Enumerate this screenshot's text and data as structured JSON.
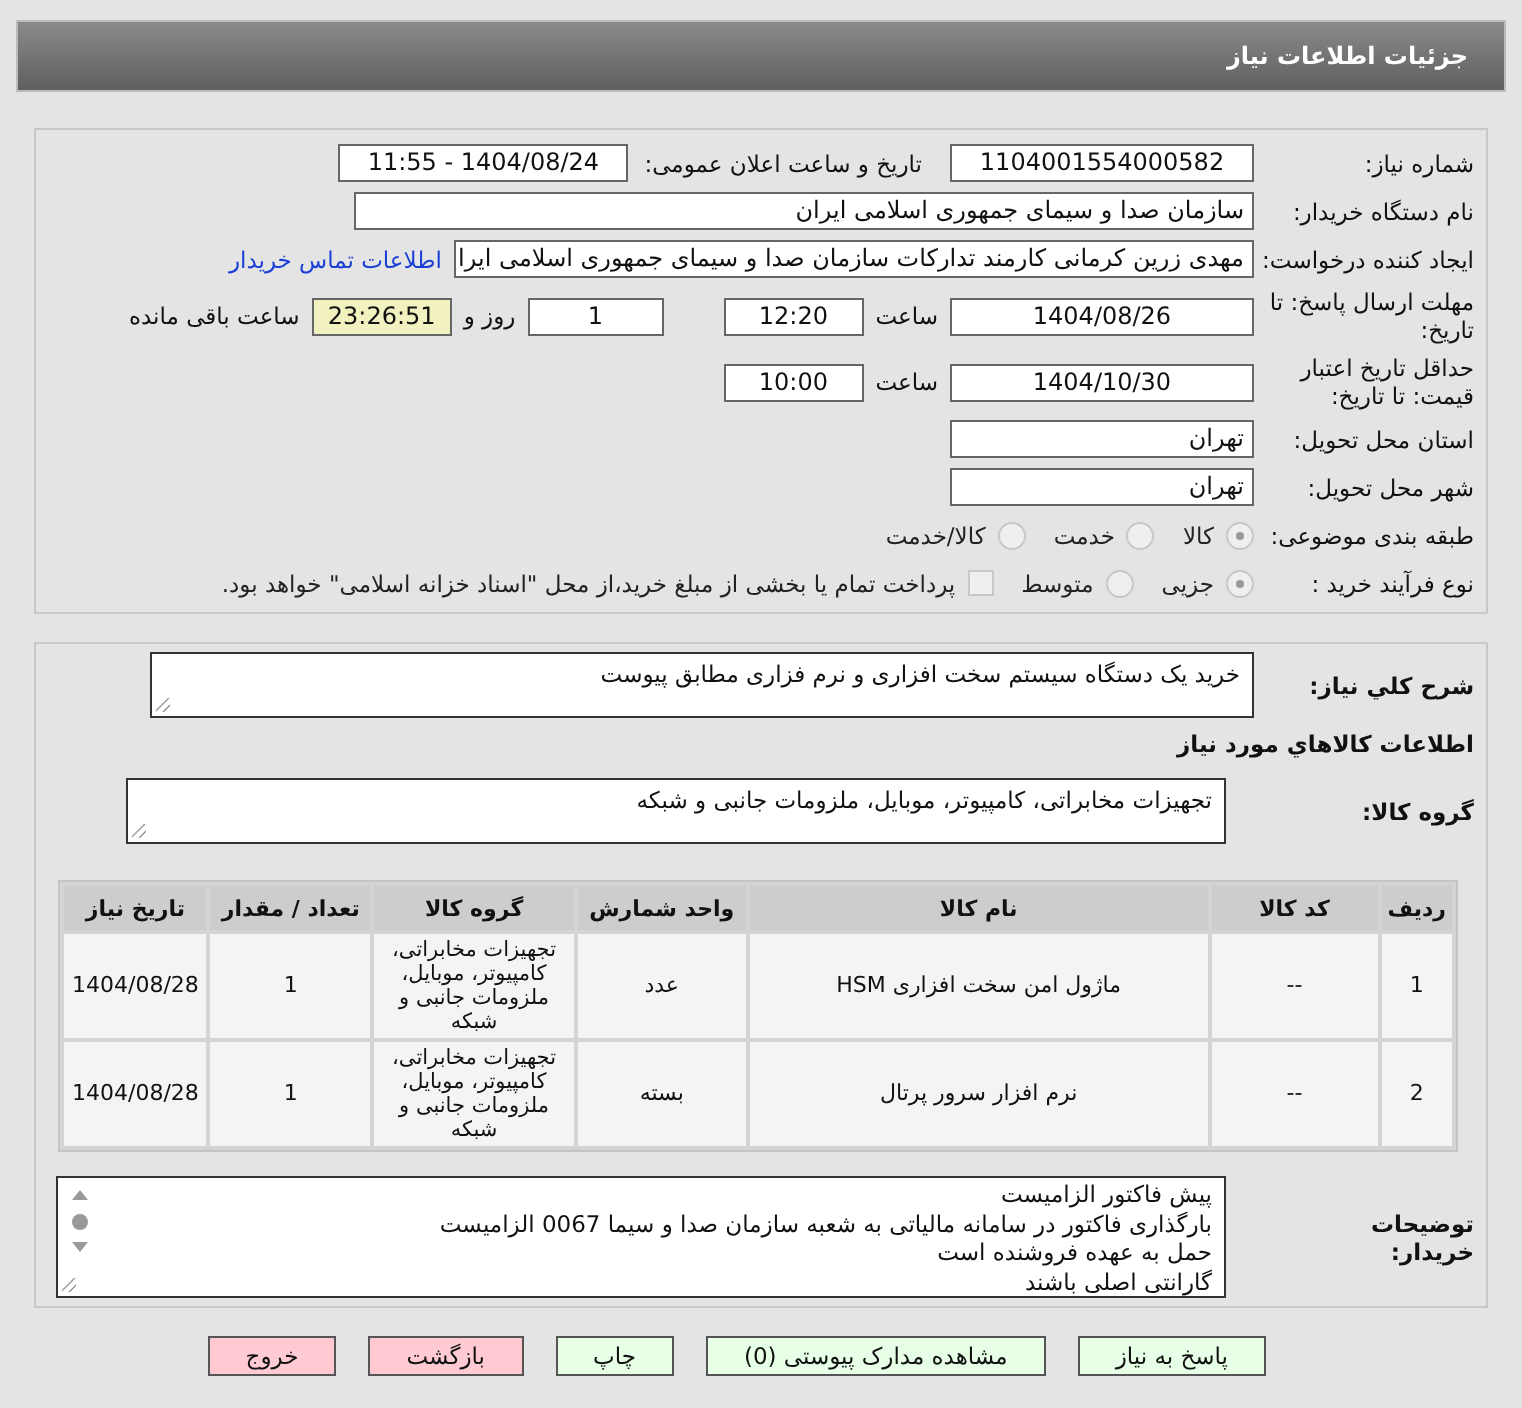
{
  "header": {
    "title": "جزئیات اطلاعات نیاز"
  },
  "need_number": {
    "label": "شماره نیاز:",
    "value": "1104001554000582"
  },
  "announce": {
    "label": "تاریخ و ساعت اعلان عمومی:",
    "value": "1404/08/24 - 11:55"
  },
  "buyer_org": {
    "label": "نام دستگاه خریدار:",
    "value": "سازمان صدا و سیمای جمهوری اسلامی ایران"
  },
  "requester": {
    "label": "ایجاد کننده درخواست:",
    "value": "مهدی زرین کرمانی کارمند تدارکات سازمان صدا و سیمای جمهوری اسلامی ایرا",
    "link": "اطلاعات تماس خریدار"
  },
  "deadline": {
    "label": "مهلت ارسال پاسخ: تا تاریخ:",
    "date": "1404/08/26",
    "time_label": "ساعت",
    "time": "12:20",
    "days": "1",
    "days_label": "روز و",
    "remaining": "23:26:51",
    "remaining_label": "ساعت باقی مانده"
  },
  "validity": {
    "label": "حداقل تاریخ اعتبار قیمت: تا تاریخ:",
    "date": "1404/10/30",
    "time_label": "ساعت",
    "time": "10:00"
  },
  "province": {
    "label": "استان محل تحویل:",
    "value": "تهران"
  },
  "city": {
    "label": "شهر محل تحویل:",
    "value": "تهران"
  },
  "category": {
    "label": "طبقه بندی موضوعی:",
    "options": [
      {
        "label": "کالا",
        "selected": true
      },
      {
        "label": "خدمت",
        "selected": false
      },
      {
        "label": "کالا/خدمت",
        "selected": false
      }
    ]
  },
  "process": {
    "label": "نوع فرآیند خرید :",
    "options": [
      {
        "label": "جزیی",
        "selected": true
      },
      {
        "label": "متوسط",
        "selected": false
      }
    ],
    "payment": {
      "label": "پرداخت تمام یا بخشی از مبلغ خرید،از محل \"اسناد خزانه اسلامی\" خواهد بود.",
      "checked": false
    }
  },
  "summary": {
    "label": "شرح کلي نياز:",
    "value": "خرید یک دستگاه سیستم  سخت افزاری و نرم فزاری مطابق پیوست"
  },
  "goods_heading": "اطلاعات کالاهاي مورد نياز",
  "goods_group": {
    "label": "گروه کالا:",
    "value": "تجهیزات مخابراتی، کامپیوتر، موبایل، ملزومات جانبی و شبکه"
  },
  "table": {
    "columns": [
      "ردیف",
      "کد کالا",
      "نام کالا",
      "واحد شمارش",
      "گروه کالا",
      "تعداد / مقدار",
      "تاریخ نیاز"
    ],
    "rows": [
      [
        "1",
        "--",
        "ماژول امن سخت افزاری HSM",
        "عدد",
        "تجهیزات مخابراتی، کامپیوتر، موبایل، ملزومات جانبی و شبکه",
        "1",
        "1404/08/28"
      ],
      [
        "2",
        "--",
        "نرم افزار سرور پرتال",
        "بسته",
        "تجهیزات مخابراتی، کامپیوتر، موبایل، ملزومات جانبی و شبکه",
        "1",
        "1404/08/28"
      ]
    ]
  },
  "notes": {
    "label": "توضیحات خریدار:",
    "lines": [
      "پیش فاکتور الزامیست",
      "بارگذاری فاکتور در سامانه مالیاتی به شعبه سازمان صدا و سیما 0067 الزامیست",
      "حمل به عهده فروشنده است",
      "گارانتی اصلی باشند"
    ]
  },
  "buttons": [
    {
      "label": "پاسخ به نیاز",
      "kind": "go"
    },
    {
      "label": "مشاهده مدارک پیوستی (0)",
      "kind": "go"
    },
    {
      "label": "چاپ",
      "kind": "go"
    },
    {
      "label": "بازگشت",
      "kind": "stop"
    },
    {
      "label": "خروج",
      "kind": "stop"
    }
  ]
}
